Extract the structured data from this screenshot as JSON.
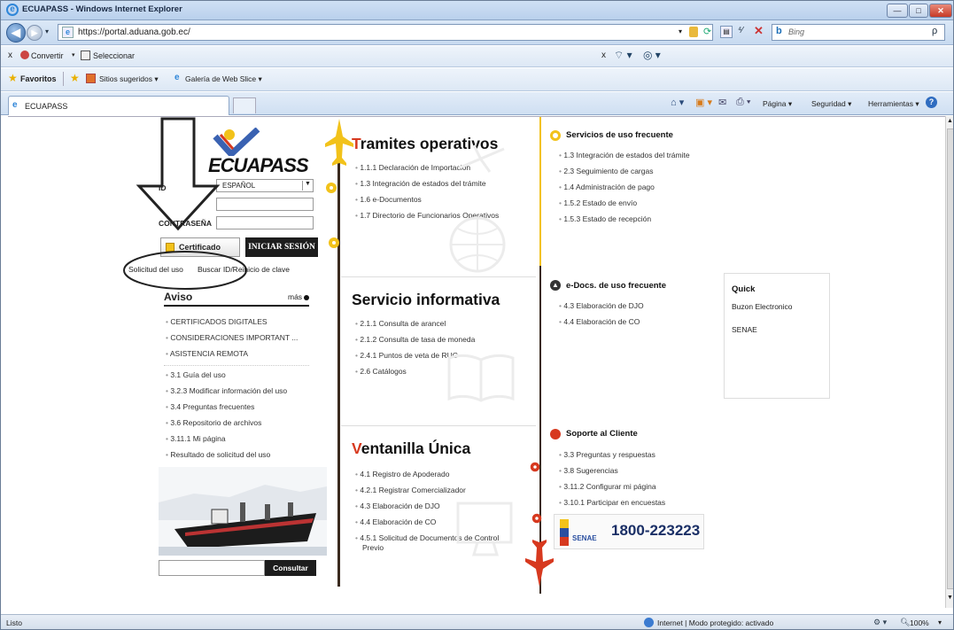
{
  "window": {
    "title": "ECUAPASS - Windows Internet Explorer",
    "minimize_label": "—",
    "maximize_label": "□",
    "close_label": "✕"
  },
  "address": {
    "url": "https://portal.aduana.gob.ec/",
    "search_placeholder": "Bing",
    "search_icon_text": "ρ"
  },
  "toolbar1": {
    "close_label": "x",
    "convertir": "Convertir",
    "seleccionar": "Seleccionar"
  },
  "favbar": {
    "favoritos": "Favoritos",
    "sitios": "Sitios sugeridos ▾",
    "galeria": "Galería de Web Slice ▾"
  },
  "tabbar": {
    "tab_title": "ECUAPASS",
    "pagina": "Página ▾",
    "seguridad": "Seguridad ▾",
    "herramientas": "Herramientas ▾"
  },
  "login": {
    "logo": "ECUAPASS",
    "id_label": "ID",
    "lang_value": "ESPAÑOL",
    "pwd_label": "CONTRASEÑA",
    "cert_button": "Certificado",
    "login_button": "INICIAR SESIÓN",
    "solicitud_link": "Solicitud del uso",
    "buscar_link": "Buscar ID/Reinicio de clave"
  },
  "aviso": {
    "title": "Aviso",
    "more": "más",
    "items": [
      "CERTIFICADOS DIGITALES",
      "CONSIDERACIONES IMPORTANT ...",
      "ASISTENCIA REMOTA"
    ]
  },
  "guide": {
    "items": [
      "3.1 Guía del uso",
      "3.2.3 Modificar información del uso",
      "3.4 Preguntas frecuentes",
      "3.6 Repositorio de archivos",
      "3.11.1 Mi página",
      "Resultado de solicitud del uso"
    ]
  },
  "consultar": {
    "button": "Consultar"
  },
  "tramites": {
    "title_first": "T",
    "title_rest": "ramites operativos",
    "items": [
      "1.1.1 Declaración de Importación",
      "1.3 Integración de estados del trámite",
      "1.6 e-Documentos",
      "1.7 Directorio de Funcionarios Operativos"
    ]
  },
  "servicio": {
    "title": "Servicio informativa",
    "items": [
      "2.1.1 Consulta de arancel",
      "2.1.2 Consulta de tasa de moneda",
      "2.4.1 Puntos de veta de RUC",
      "2.6 Catálogos"
    ]
  },
  "ventanilla": {
    "title_first": "V",
    "title_rest": "entanilla Única",
    "items": [
      "4.1 Registro de Apoderado",
      "4.2.1 Registrar Comercializador",
      "4.3 Elaboración de DJO",
      "4.4 Elaboración de CO"
    ],
    "last_item_line1": "4.5.1 Solicitud de Documentos de Control",
    "last_item_line2": "Previo"
  },
  "servicios_frecuentes": {
    "title": "Servicios de uso frecuente",
    "items": [
      "1.3 Integración de estados del trámite",
      "2.3 Seguimiento de cargas",
      "1.4 Administración de pago",
      "1.5.2 Estado de envío",
      "1.5.3 Estado de recepción"
    ]
  },
  "edocs": {
    "title": "e-Docs. de uso frecuente",
    "items": [
      "4.3 Elaboración de DJO",
      "4.4 Elaboración de CO"
    ]
  },
  "quick": {
    "title": "Quick",
    "items": [
      "Buzon Electronico",
      "SENAE"
    ]
  },
  "soporte": {
    "title": "Soporte al Cliente",
    "items": [
      "3.3 Preguntas y respuestas",
      "3.8 Sugerencias",
      "3.11.2 Configurar mi página",
      "3.10.1 Participar en encuestas"
    ],
    "phone": "1800-223223",
    "senae_logo": "SENAE"
  },
  "status": {
    "left": "Listo",
    "zone": "Internet | Modo protegido: activado",
    "zoom": "100%"
  },
  "colors": {
    "accent_red": "#d7391f",
    "accent_yellow": "#f2c21a",
    "ie_blue": "#3d6ea8"
  }
}
